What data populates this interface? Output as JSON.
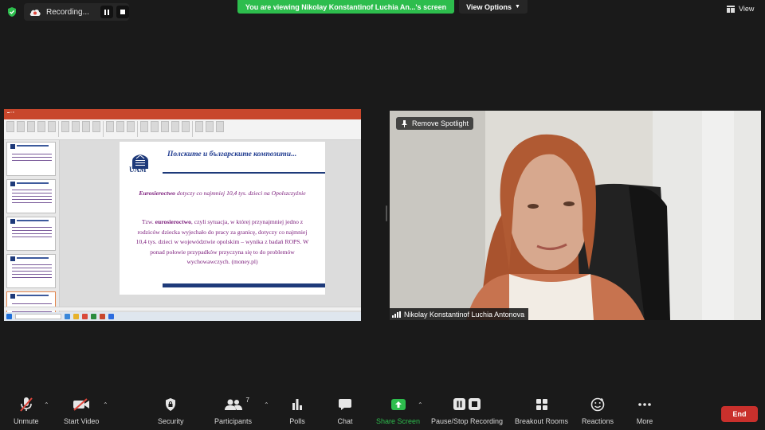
{
  "recording": {
    "label": "Recording..."
  },
  "banner": {
    "viewing_text": "You are viewing Nikolay Konstantinof Luchia An...'s screen",
    "view_options": "View Options"
  },
  "view_button": "View",
  "slide": {
    "title": "Полските и българските композити...",
    "logo_text": "UAM",
    "subtitle_bold": "Eurosieroctwo",
    "subtitle_rest": "dotyczy co najmniej 10,4 tys. dzieci na Opolszczyźnie",
    "para_start": "Tzw. ",
    "para_bold": "eurosieroctwo",
    "para_rest": ", czyli sytuacja, w której przynajmniej jedno z rodziców dziecka wyjechało do pracy za granicę, dotyczy co najmniej 10,4 tys. dzieci w województwie opolskim – wynika z badań ROPS. W ponad połowie przypadków przyczyna się to do problemów wychowawczych. (money.pl)"
  },
  "video": {
    "remove_spotlight": "Remove Spotlight",
    "participant_name": "Nikolay Konstantinof Luchia Antonova"
  },
  "toolbar": {
    "unmute": "Unmute",
    "start_video": "Start Video",
    "security": "Security",
    "participants": "Participants",
    "participants_count": "7",
    "polls": "Polls",
    "chat": "Chat",
    "share_screen": "Share Screen",
    "pause_stop_recording": "Pause/Stop Recording",
    "breakout_rooms": "Breakout Rooms",
    "reactions": "Reactions",
    "more": "More",
    "end": "End"
  },
  "colors": {
    "accent_green": "#2dbd4d",
    "end_red": "#c9302c",
    "ppt_orange": "#c8472c",
    "slide_navy": "#1e3a7a",
    "slide_purple": "#7a1a7a"
  }
}
